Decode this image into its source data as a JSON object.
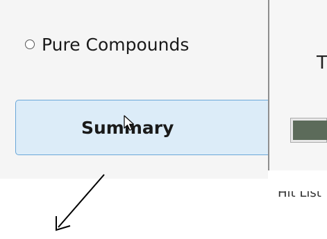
{
  "options": {
    "pure_compounds_label": "Pure Compounds"
  },
  "actions": {
    "summary_label": "Summary"
  },
  "right_panel": {
    "header_glyph": "T",
    "hit_list_label": "Hit List"
  },
  "colors": {
    "button_background": "#dcecf8",
    "button_border": "#6aa6d8",
    "progress_fill": "#5c6b5a"
  },
  "icons": [
    "radio-unselected-icon",
    "mouse-pointer-icon",
    "annotation-arrow-icon"
  ]
}
